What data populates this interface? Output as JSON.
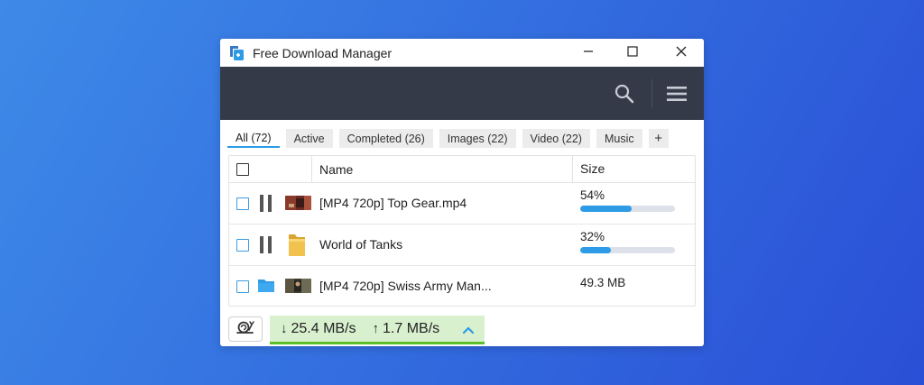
{
  "window": {
    "title": "Free Download Manager",
    "minimize_icon": "minimize-icon",
    "maximize_icon": "maximize-icon",
    "close_icon": "close-icon"
  },
  "toolbar": {
    "search_icon": "search-icon",
    "menu_icon": "hamburger-menu-icon"
  },
  "tabs": [
    {
      "label": "All (72)",
      "active": true
    },
    {
      "label": "Active",
      "active": false
    },
    {
      "label": "Completed (26)",
      "active": false
    },
    {
      "label": "Images (22)",
      "active": false
    },
    {
      "label": "Video (22)",
      "active": false
    },
    {
      "label": "Music",
      "active": false
    },
    {
      "label": "+",
      "active": false
    }
  ],
  "table": {
    "columns": {
      "name": "Name",
      "size": "Size"
    },
    "rows": [
      {
        "name": "[MP4 720p] Top Gear.mp4",
        "status": "downloading",
        "progress_label": "54%",
        "progress": 0.54,
        "thumb": "video-thumbnail"
      },
      {
        "name": "World of Tanks",
        "status": "downloading",
        "progress_label": "32%",
        "progress": 0.32,
        "thumb": "folder-icon"
      },
      {
        "name": "[MP4 720p] Swiss Army Man...",
        "status": "completed",
        "size": "49.3 MB",
        "thumb": "video-thumbnail"
      }
    ]
  },
  "statusbar": {
    "snail_icon": "snail-icon",
    "download_speed": "25.4 MB/s",
    "upload_speed": "1.7 MB/s",
    "download_arrow": "↓",
    "upload_arrow": "↑"
  },
  "colors": {
    "accent": "#2d9be6",
    "toolbar_bg": "#353a48",
    "speed_bg": "#d9f0cf",
    "speed_border": "#5cbf2a"
  }
}
